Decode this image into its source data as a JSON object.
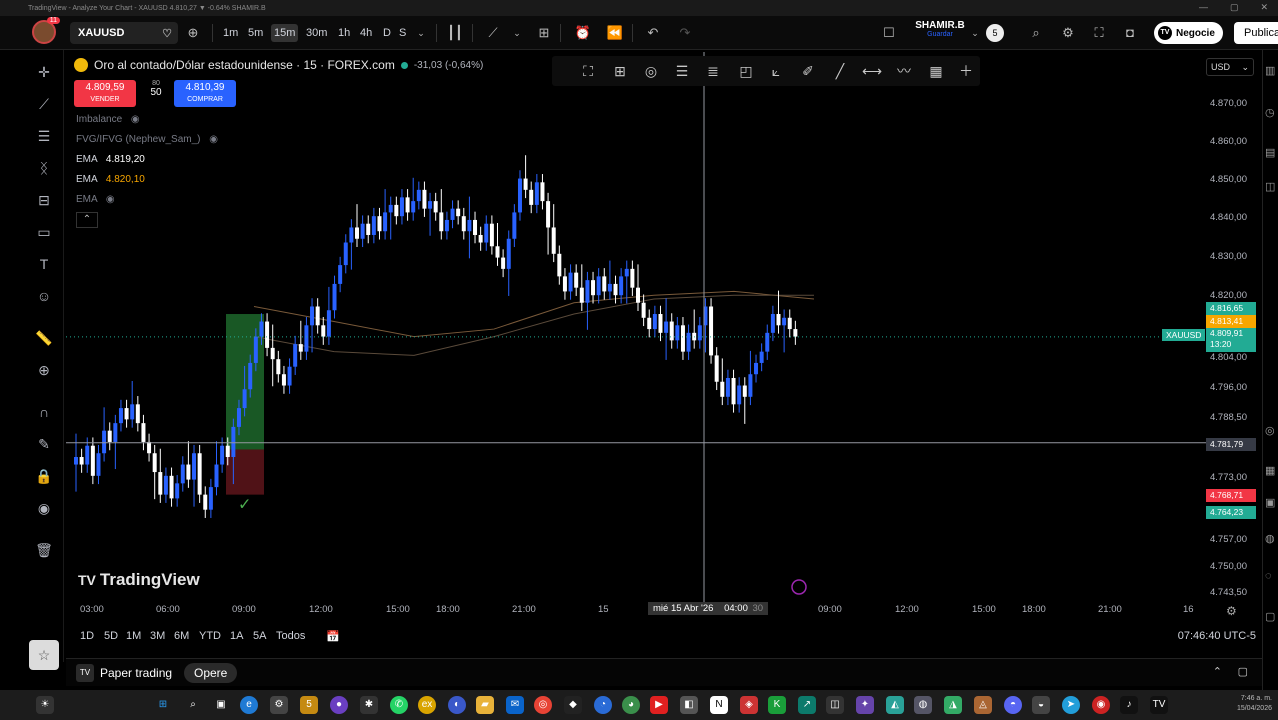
{
  "window": {
    "title": "TradingView - Analyze Your Chart - XAUUSD 4.810,27 ▼ -0.64% SHAMIR.B"
  },
  "topbar": {
    "symbol": "XAUUSD",
    "timeframes": [
      "1m",
      "5m",
      "15m",
      "30m",
      "1h",
      "4h",
      "D",
      "S"
    ],
    "active_timeframe": "15m",
    "user_name": "SHAMIR.B",
    "user_sub": "Guardar",
    "count_badge": "5",
    "notif_badge": "11",
    "negocie": "Negocie",
    "publicar": "Publica"
  },
  "legend": {
    "title": "Oro al contado/Dólar estadounidense · 15 · FOREX.com",
    "change": "-31,03 (-0,64%)",
    "sell_price": "4.809,59",
    "sell_label": "VENDER",
    "buy_price": "4.810,39",
    "buy_label": "COMPRAR",
    "spread_label": "80",
    "spread_value": "50",
    "indicators": [
      {
        "name": "Imbalance",
        "value": ""
      },
      {
        "name": "FVG/IFVG (Nephew_Sam_)",
        "value": ""
      },
      {
        "name": "EMA",
        "value": "4.819,20"
      },
      {
        "name": "EMA",
        "value": "4.820,10"
      },
      {
        "name": "EMA",
        "value": ""
      }
    ]
  },
  "price_scale": {
    "currency": "USD",
    "ticks": [
      "4.870,00",
      "4.860,00",
      "4.850,00",
      "4.840,00",
      "4.830,00",
      "4.820,00",
      "4.804,00",
      "4.796,00",
      "4.788,50",
      "4.773,00",
      "4.757,00",
      "4.750,00",
      "4.743,50"
    ],
    "tag_green_1": "4.816,65",
    "tag_orange": "4.813,41",
    "tag_current": "4.809,91",
    "tag_timer": "13:20",
    "tag_symbol": "XAUUSD",
    "tag_crosshair": "4.781,79",
    "tag_red": "4.768,71",
    "tag_green_2": "4.764,23"
  },
  "time_axis": {
    "ticks": [
      "03:00",
      "06:00",
      "09:00",
      "12:00",
      "15:00",
      "18:00",
      "21:00",
      "15",
      "04:00",
      "09:00",
      "12:00",
      "15:00",
      "18:00",
      "21:00",
      "16"
    ],
    "crosshair_label": "mié 15 Abr '26",
    "crosshair_tail": "30"
  },
  "watermark": "TradingView",
  "range_buttons": [
    "1D",
    "5D",
    "1M",
    "3M",
    "6M",
    "YTD",
    "1A",
    "5A",
    "Todos"
  ],
  "clock": "07:46:40 UTC-5",
  "bottom": {
    "paper_trading": "Paper trading",
    "opere": "Opere"
  },
  "tray": {
    "time": "7:46 a. m.",
    "date": "15/04/2026"
  },
  "chart_data": {
    "type": "candlestick",
    "symbol": "XAUUSD",
    "interval": "15",
    "up_color": "#2962ff",
    "down_color": "#ffffff",
    "ylim": [
      4740,
      4875
    ],
    "closes": [
      4778,
      4776,
      4781,
      4773,
      4779,
      4785,
      4782,
      4787,
      4791,
      4788,
      4792,
      4787,
      4782,
      4779,
      4774,
      4768,
      4773,
      4767,
      4771,
      4776,
      4772,
      4779,
      4768,
      4764,
      4770,
      4776,
      4781,
      4778,
      4786,
      4791,
      4796,
      4803,
      4810,
      4814,
      4807,
      4804,
      4800,
      4797,
      4802,
      4808,
      4806,
      4813,
      4818,
      4813,
      4810,
      4817,
      4824,
      4829,
      4835,
      4839,
      4836,
      4840,
      4837,
      4842,
      4838,
      4843,
      4845,
      4842,
      4847,
      4843,
      4846,
      4849,
      4844,
      4846,
      4843,
      4838,
      4841,
      4844,
      4842,
      4838,
      4841,
      4837,
      4835,
      4840,
      4834,
      4831,
      4828,
      4836,
      4843,
      4852,
      4849,
      4845,
      4851,
      4846,
      4839,
      4832,
      4826,
      4822,
      4827,
      4823,
      4819,
      4825,
      4821,
      4826,
      4822,
      4824,
      4821,
      4826,
      4828,
      4823,
      4819,
      4815,
      4812,
      4816,
      4811,
      4814,
      4809,
      4813,
      4806,
      4811,
      4809,
      4813,
      4818,
      4805,
      4798,
      4794,
      4799,
      4792,
      4797,
      4794,
      4800,
      4803,
      4806,
      4811,
      4816,
      4813,
      4815,
      4812,
      4810
    ],
    "ema_fast": [
      4818,
      4814,
      4810,
      4812,
      4819,
      4821,
      4822,
      4820
    ],
    "ema_slow": [
      4810,
      4806,
      4805,
      4810,
      4816,
      4820,
      4821,
      4821
    ],
    "crosshair_price": 4781.79,
    "current_price": 4809.91
  }
}
